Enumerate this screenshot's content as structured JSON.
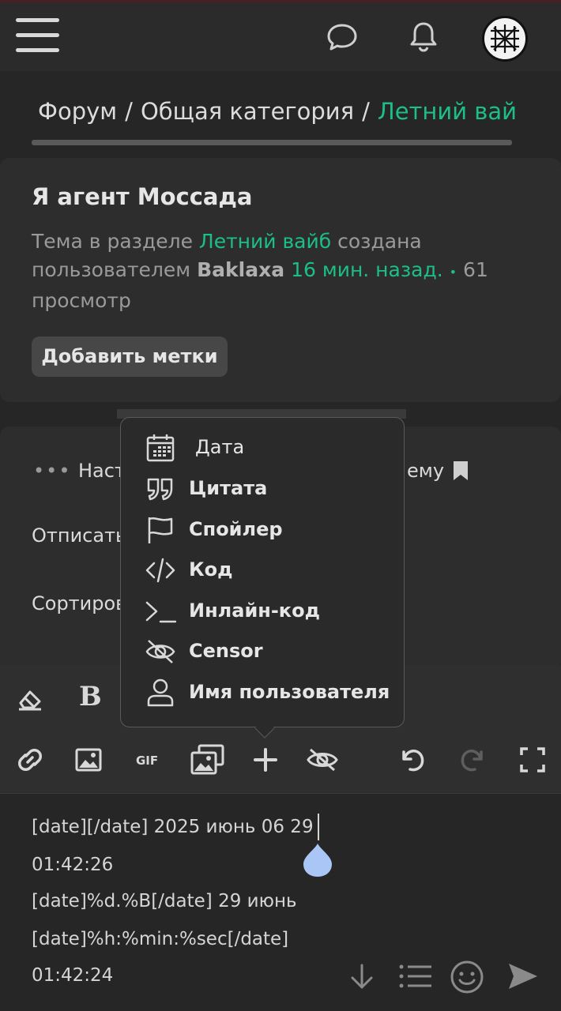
{
  "breadcrumb": {
    "items": [
      "Форум",
      "Общая категория"
    ],
    "current": "Летний вай",
    "separator": "/"
  },
  "topic": {
    "title": "Я агент Моссада",
    "meta_prefix": "Тема в разделе",
    "section": "Летний вайб",
    "meta_created": "создана пользователем",
    "author": "Baklaxa",
    "time": "16 мин. назад.",
    "dot": "•",
    "views": "61 просмотр",
    "add_tags": "Добавить метки"
  },
  "card2": {
    "dots": "•••",
    "settings_partial": "Наст",
    "topic_partial": "ему",
    "unsubscribe_partial": "Отписать",
    "sort_partial": "Сортиров"
  },
  "popup_menu": {
    "items": [
      {
        "label": "Дата",
        "icon": "calendar-icon"
      },
      {
        "label": "Цитата",
        "icon": "quote-icon"
      },
      {
        "label": "Спойлер",
        "icon": "flag-icon"
      },
      {
        "label": "Код",
        "icon": "code-icon"
      },
      {
        "label": "Инлайн-код",
        "icon": "terminal-icon"
      },
      {
        "label": "Censor",
        "icon": "eye-off-icon"
      },
      {
        "label": "Имя пользователя",
        "icon": "user-icon"
      }
    ]
  },
  "toolbar": {
    "gif_label": "GIF"
  },
  "editor": {
    "lines": [
      "[date][/date] 2025 июнь 06 29",
      "01:42:26",
      "[date]%d.%B[/date] 29 июнь",
      "[date]%h:%min:%sec[/date]",
      "01:42:24"
    ]
  },
  "colors": {
    "accent": "#1dbf86",
    "background": "#262626",
    "card": "#2d2d2d"
  }
}
